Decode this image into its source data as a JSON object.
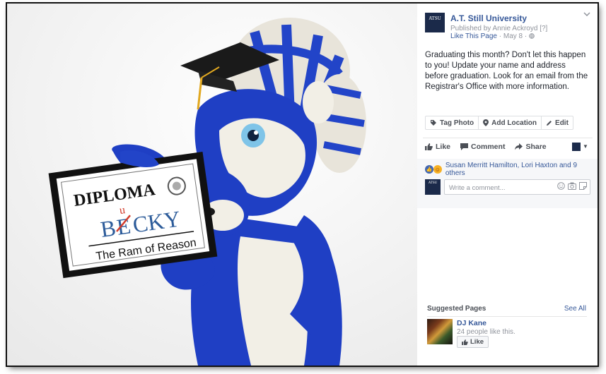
{
  "page": {
    "logo_text": "ATSU",
    "name": "A.T. Still University",
    "published_by": "Published by Annie Ackroyd [?]",
    "like_page": "Like This Page",
    "date": "· May 8 ·"
  },
  "post": {
    "text": "Graduating this month? Don't let this happen to you! Update your name and address before graduation. Look for an email from the Registrar's Office with more information.",
    "photo_actions": {
      "tag": "Tag Photo",
      "location": "Add Location",
      "edit": "Edit"
    },
    "diploma": {
      "title": "DIPLOMA",
      "crossed_letter": "E",
      "insert_letter": "u",
      "name_start": "B",
      "name_end": "CKY",
      "subtitle": "The Ram of Reason"
    }
  },
  "engagement": {
    "like": "Like",
    "comment": "Comment",
    "share": "Share",
    "reactions_text": "Susan Merritt Hamilton, Lori Haxton and 9 others"
  },
  "comment": {
    "placeholder": "Write a comment..."
  },
  "suggested": {
    "title": "Suggested Pages",
    "see_all": "See All",
    "items": [
      {
        "name": "DJ Kane",
        "likes": "24 people like this.",
        "button": "Like"
      }
    ]
  },
  "colors": {
    "link": "#365899",
    "brand_dark": "#1b2a4a",
    "mascot_blue": "#1f3fc4",
    "text": "#1d2129"
  },
  "icons": [
    "tag-icon",
    "location-pin-icon",
    "pencil-icon",
    "thumbs-up-icon",
    "comment-icon",
    "share-arrow-icon",
    "chevron-down-icon",
    "globe-icon",
    "emoji-icon",
    "camera-icon",
    "sticker-icon"
  ]
}
